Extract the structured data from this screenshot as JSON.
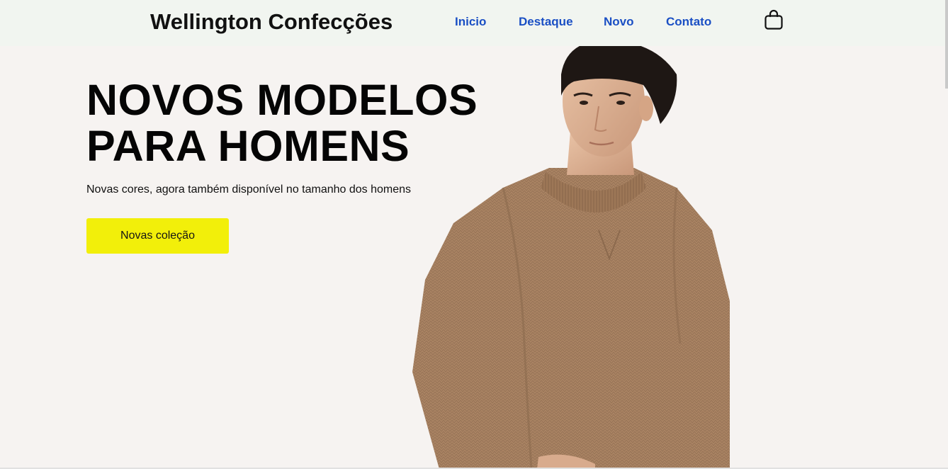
{
  "header": {
    "brand": "Wellington Confecções",
    "nav": [
      {
        "label": "Inicio"
      },
      {
        "label": "Destaque"
      },
      {
        "label": "Novo"
      },
      {
        "label": "Contato"
      }
    ],
    "cart_icon": "shopping-bag-icon"
  },
  "hero": {
    "title_line1": "NOVOS MODELOS",
    "title_line2": "PARA HOMENS",
    "subtitle": "Novas cores, agora também disponível no tamanho dos homens",
    "cta_label": "Novas coleção",
    "image": "man-in-brown-knit-sweater"
  },
  "colors": {
    "header_bg": "#f1f5f0",
    "page_bg": "#f6f3f1",
    "nav_link": "#1a4fc4",
    "cta_bg": "#f2ef0a",
    "sweater": "#a98363"
  }
}
